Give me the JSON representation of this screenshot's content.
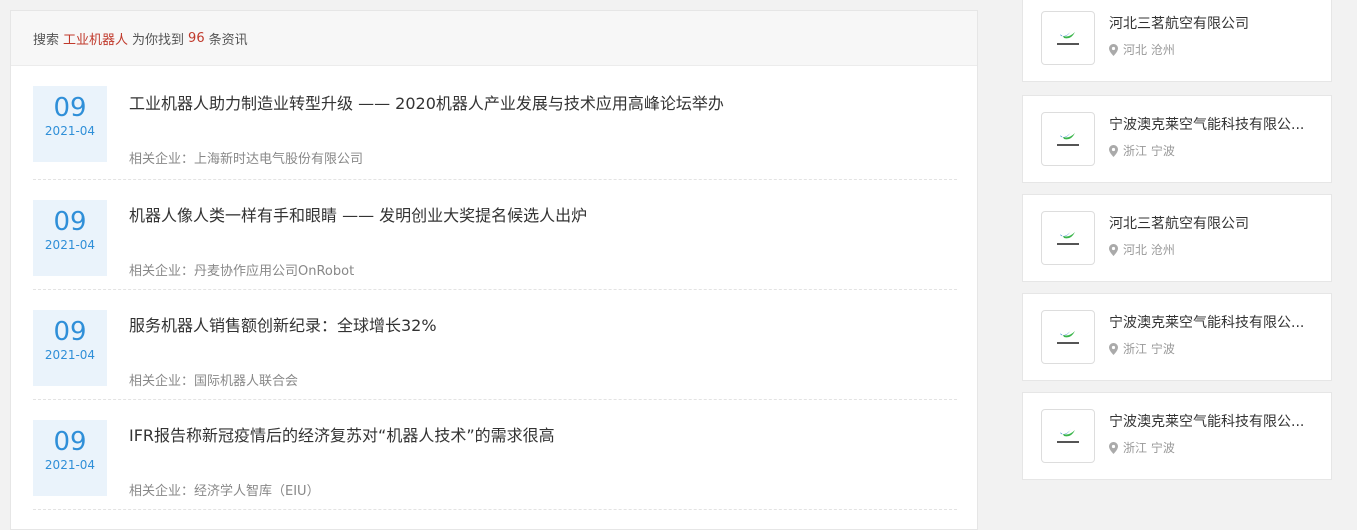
{
  "search": {
    "prefix": "搜索",
    "keyword": "工业机器人",
    "middle": "为你找到",
    "count": "96",
    "suffix": "条资讯"
  },
  "news": [
    {
      "day": "09",
      "ym": "2021-04",
      "title": "工业机器人助力制造业转型升级 —— 2020机器人产业发展与技术应用高峰论坛举办",
      "company": "相关企业：上海新时达电气股份有限公司"
    },
    {
      "day": "09",
      "ym": "2021-04",
      "title": "机器人像人类一样有手和眼睛 —— 发明创业大奖提名候选人出炉",
      "company": "相关企业：丹麦协作应用公司OnRobot"
    },
    {
      "day": "09",
      "ym": "2021-04",
      "title": "服务机器人销售额创新纪录：全球增长32%",
      "company": "相关企业：国际机器人联合会"
    },
    {
      "day": "09",
      "ym": "2021-04",
      "title": "IFR报告称新冠疫情后的经济复苏对“机器人技术”的需求很高",
      "company": "相关企业：经济学人智库（EIU）"
    }
  ],
  "companies": [
    {
      "name": "河北三茗航空有限公司",
      "location": "河北 沧州"
    },
    {
      "name": "宁波澳克莱空气能科技有限公...",
      "location": "浙江 宁波"
    },
    {
      "name": "河北三茗航空有限公司",
      "location": "河北 沧州"
    },
    {
      "name": "宁波澳克莱空气能科技有限公...",
      "location": "浙江 宁波"
    },
    {
      "name": "宁波澳克莱空气能科技有限公...",
      "location": "浙江 宁波"
    }
  ],
  "icons": {
    "location": "map-pin-icon",
    "logo": "company-logo-icon"
  },
  "colors": {
    "accent_red": "#c0392b",
    "date_blue": "#2f8fd8",
    "date_bg": "#eaf3fb"
  }
}
